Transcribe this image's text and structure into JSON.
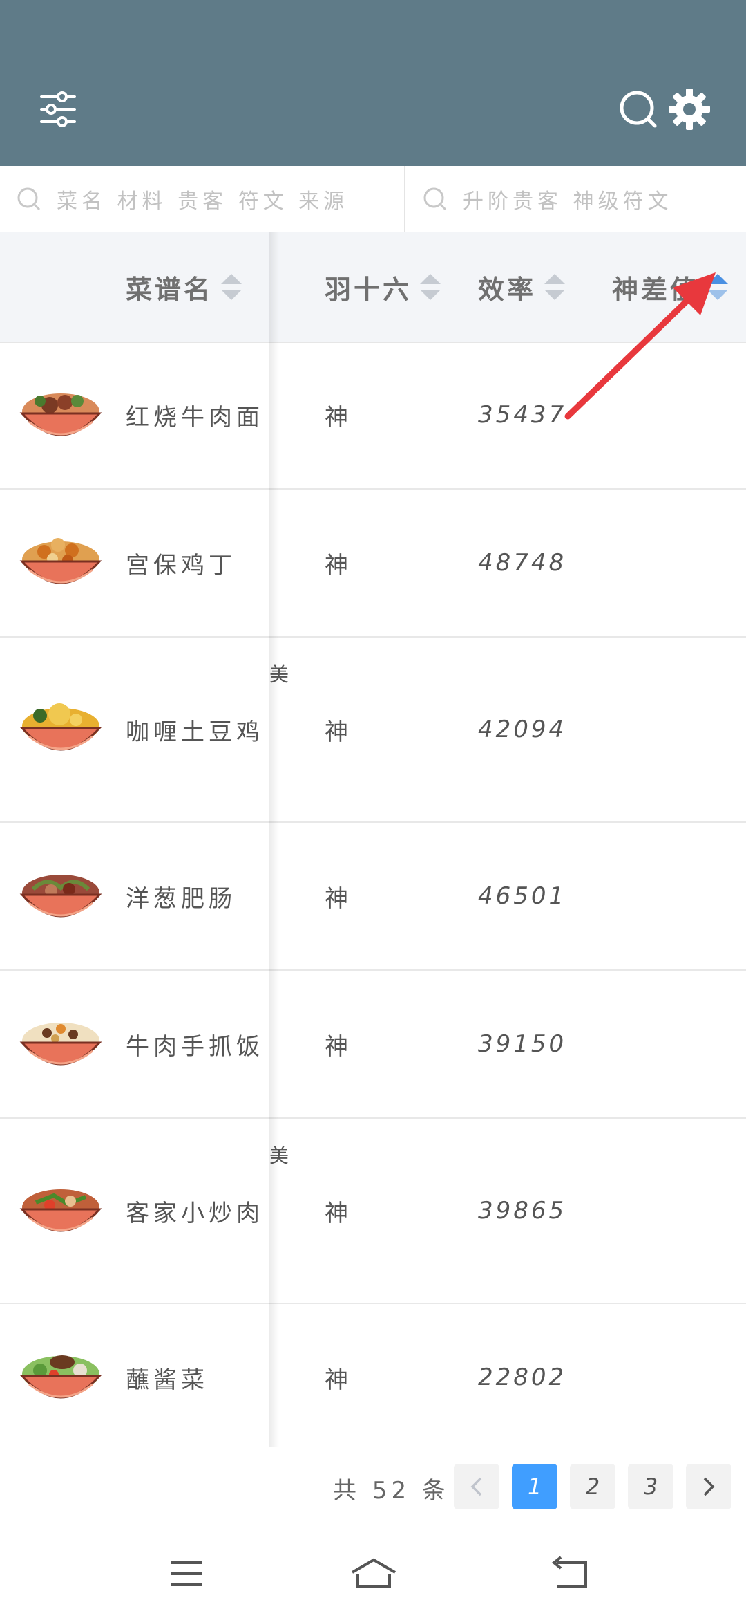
{
  "header": {
    "filter_icon": "sliders-icon",
    "search_icon": "search-icon",
    "settings_icon": "gear-icon",
    "bg_color": "#5f7b88"
  },
  "search": {
    "placeholder_main": "菜名 材料 贵客 符文 来源",
    "placeholder_secondary": "升阶贵客 神级符文"
  },
  "table": {
    "columns": [
      {
        "label": "菜谱名"
      },
      {
        "label": "羽十六"
      },
      {
        "label": "效率"
      },
      {
        "label": "神差值",
        "sort_active": true
      }
    ],
    "rows": [
      {
        "name": "红烧牛肉面",
        "rank": "神",
        "efficiency": "35437",
        "note": "",
        "image": "beef-noodle-bowl-icon"
      },
      {
        "name": "宫保鸡丁",
        "rank": "神",
        "efficiency": "48748",
        "note": "",
        "image": "kungpao-chicken-bowl-icon"
      },
      {
        "name": "咖喱土豆鸡",
        "rank": "神",
        "efficiency": "42094",
        "note": "美",
        "image": "curry-chicken-bowl-icon"
      },
      {
        "name": "洋葱肥肠",
        "rank": "神",
        "efficiency": "46501",
        "note": "",
        "image": "onion-intestine-bowl-icon"
      },
      {
        "name": "牛肉手抓饭",
        "rank": "神",
        "efficiency": "39150",
        "note": "",
        "image": "beef-pilaf-bowl-icon"
      },
      {
        "name": "客家小炒肉",
        "rank": "神",
        "efficiency": "39865",
        "note": "美",
        "image": "stirfry-pork-bowl-icon"
      },
      {
        "name": "蘸酱菜",
        "rank": "神",
        "efficiency": "22802",
        "note": "",
        "image": "dipping-veg-bowl-icon"
      }
    ]
  },
  "pagination": {
    "total": "共 52 条",
    "pages": [
      "1",
      "2",
      "3"
    ],
    "current": "1",
    "prev_icon": "chevron-left-icon",
    "next_icon": "chevron-right-icon",
    "active_color": "#409eff"
  },
  "system_nav": {
    "menu_icon": "menu-icon",
    "home_icon": "home-icon",
    "back_icon": "back-icon"
  },
  "annotation": {
    "arrow_color": "#e8383d"
  }
}
